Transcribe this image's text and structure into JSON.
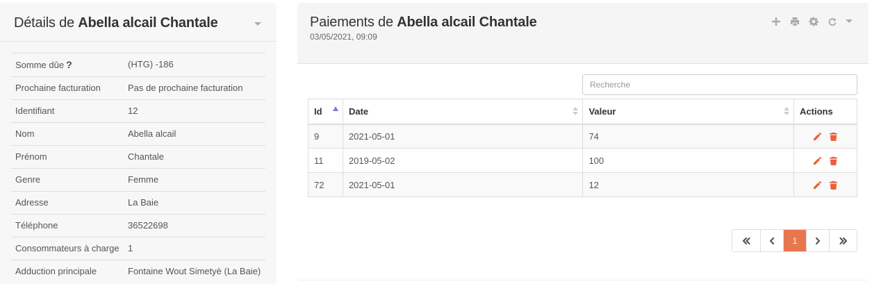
{
  "details_panel": {
    "title_prefix": "Détails de ",
    "title_name": "Abella alcail Chantale",
    "rows": [
      {
        "label": "Somme dûe",
        "value": "(HTG) -186",
        "help": "?"
      },
      {
        "label": "Prochaine facturation",
        "value": "Pas de prochaine facturation"
      },
      {
        "label": "Identifiant",
        "value": "12"
      },
      {
        "label": "Nom",
        "value": "Abella alcail"
      },
      {
        "label": "Prénom",
        "value": "Chantale"
      },
      {
        "label": "Genre",
        "value": "Femme"
      },
      {
        "label": "Adresse",
        "value": "La Baie"
      },
      {
        "label": "Téléphone",
        "value": "36522698"
      },
      {
        "label": "Consommateurs à charge",
        "value": "1"
      },
      {
        "label": "Adduction principale",
        "value": "Fontaine Wout Simetyè (La Baie)"
      }
    ]
  },
  "payments_panel": {
    "title_prefix": "Paiements de ",
    "title_name": "Abella alcail Chantale",
    "subtitle": "03/05/2021, 09:09",
    "tools": [
      "plus-icon",
      "print-icon",
      "gear-icon",
      "refresh-icon",
      "caret-down-icon"
    ],
    "search_placeholder": "Recherche",
    "columns": [
      "Id",
      "Date",
      "Valeur",
      "Actions"
    ],
    "rows": [
      {
        "id": "9",
        "date": "2021-05-01",
        "value": "74"
      },
      {
        "id": "11",
        "date": "2019-05-02",
        "value": "100"
      },
      {
        "id": "72",
        "date": "2021-05-01",
        "value": "12"
      }
    ],
    "pagination": {
      "current_page": "1"
    },
    "accent_color": "#e8774f"
  }
}
